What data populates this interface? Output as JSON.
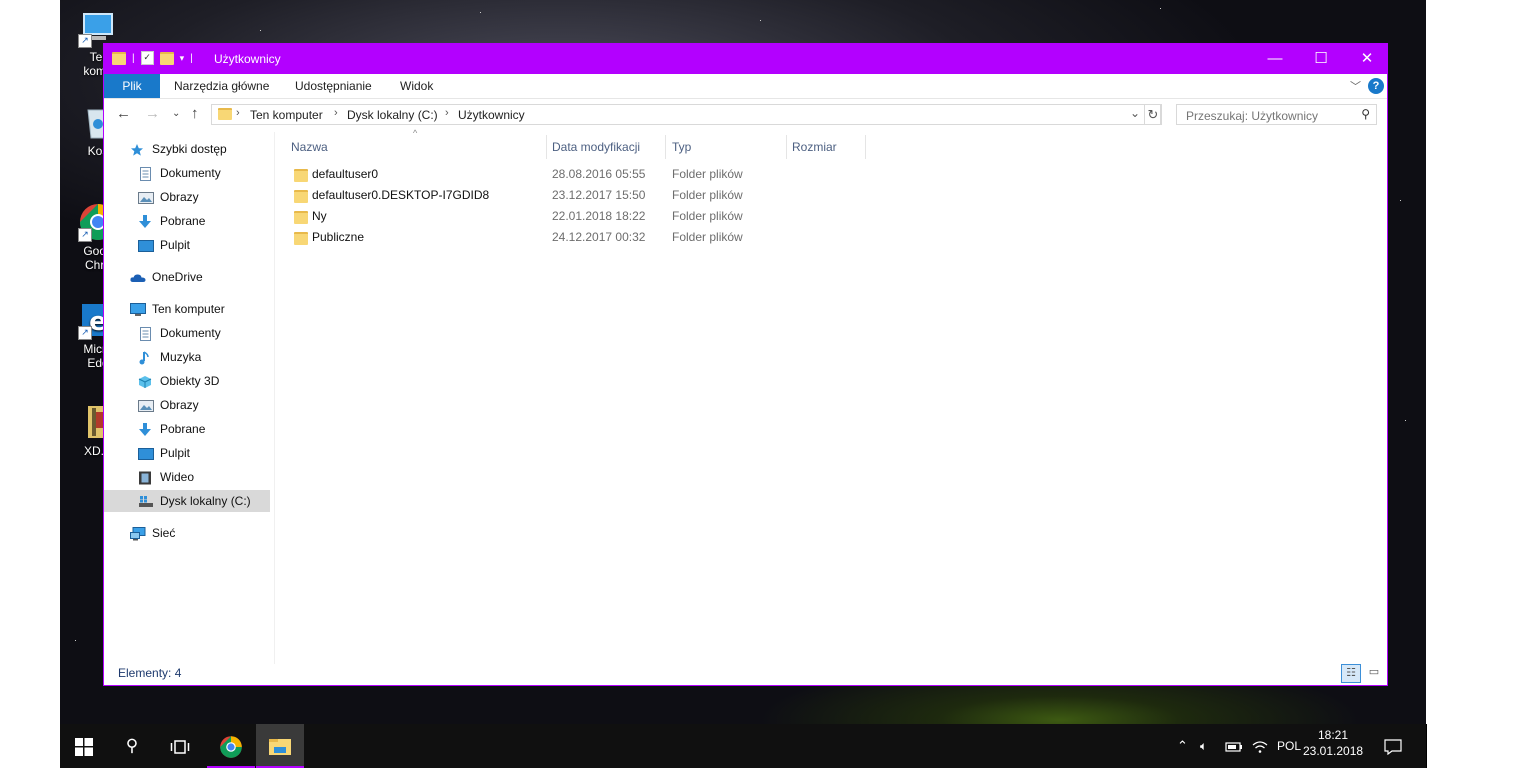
{
  "desktop": {
    "icons": [
      {
        "label": "Ten komputer",
        "short": "Ter\nkomp"
      },
      {
        "label": "Kosz",
        "short": "Kos"
      },
      {
        "label": "Google Chrome",
        "short": "Goog\nChro"
      },
      {
        "label": "Microsoft Edge",
        "short": "Micro\nEdg"
      },
      {
        "label": "XD.P",
        "short": "XD.P"
      }
    ]
  },
  "window": {
    "title": "Użytkownicy",
    "accent": "#b300ff",
    "controls": {
      "minimize": "—",
      "maximize": "☐",
      "close": "✕"
    }
  },
  "ribbon": {
    "tabs": [
      "Plik",
      "Narzędzia główne",
      "Udostępnianie",
      "Widok"
    ],
    "file_color": "#1979ca",
    "help": "?"
  },
  "navbar": {
    "breadcrumb": [
      "Ten komputer",
      "Dysk lokalny (C:)",
      "Użytkownicy"
    ],
    "search_placeholder": "Przeszukaj: Użytkownicy"
  },
  "navpane": {
    "items": [
      {
        "label": "Szybki dostęp",
        "icon": "star-icon"
      },
      {
        "label": "Dokumenty",
        "icon": "document-icon"
      },
      {
        "label": "Obrazy",
        "icon": "pictures-icon"
      },
      {
        "label": "Pobrane",
        "icon": "download-icon"
      },
      {
        "label": "Pulpit",
        "icon": "desktop-icon"
      },
      {
        "label": "OneDrive",
        "icon": "cloud-icon"
      },
      {
        "label": "Ten komputer",
        "icon": "computer-icon"
      },
      {
        "label": "Dokumenty",
        "icon": "document-icon"
      },
      {
        "label": "Muzyka",
        "icon": "music-icon"
      },
      {
        "label": "Obiekty 3D",
        "icon": "cube-icon"
      },
      {
        "label": "Obrazy",
        "icon": "pictures-icon"
      },
      {
        "label": "Pobrane",
        "icon": "download-icon"
      },
      {
        "label": "Pulpit",
        "icon": "desktop-icon"
      },
      {
        "label": "Wideo",
        "icon": "video-icon"
      },
      {
        "label": "Dysk lokalny (C:)",
        "icon": "drive-icon"
      },
      {
        "label": "Sieć",
        "icon": "network-icon"
      }
    ]
  },
  "filelist": {
    "columns": [
      "Nazwa",
      "Data modyfikacji",
      "Typ",
      "Rozmiar"
    ],
    "rows": [
      {
        "name": "defaultuser0",
        "date": "28.08.2016 05:55",
        "type": "Folder plików",
        "size": ""
      },
      {
        "name": "defaultuser0.DESKTOP-I7GDID8",
        "date": "23.12.2017 15:50",
        "type": "Folder plików",
        "size": ""
      },
      {
        "name": "Ny",
        "date": "22.01.2018 18:22",
        "type": "Folder plików",
        "size": ""
      },
      {
        "name": "Publiczne",
        "date": "24.12.2017 00:32",
        "type": "Folder plików",
        "size": ""
      }
    ]
  },
  "statusbar": {
    "count": "Elementy: 4"
  },
  "taskbar": {
    "language": "POL",
    "time": "18:21",
    "date": "23.01.2018"
  }
}
